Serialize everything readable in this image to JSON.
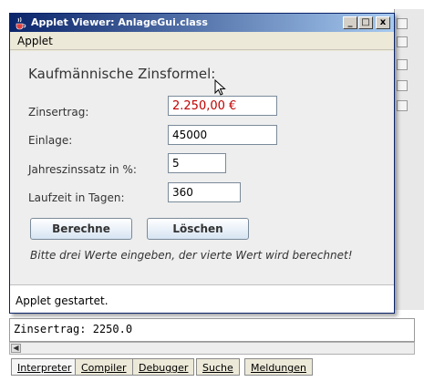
{
  "window": {
    "title": "Applet Viewer: AnlageGui.class",
    "controls": {
      "minimize": "_",
      "maximize": "□",
      "close": "x"
    }
  },
  "menu": {
    "items": [
      "Applet"
    ]
  },
  "form": {
    "heading": "Kaufmännische Zinsformel:",
    "fields": [
      {
        "label": "Zinsertrag:",
        "value": "2.250,00 €",
        "is_result": true
      },
      {
        "label": "Einlage:",
        "value": "45000"
      },
      {
        "label": "Jahreszinssatz in %:",
        "value": "5"
      },
      {
        "label": "Laufzeit in Tagen:",
        "value": "360"
      }
    ],
    "buttons": {
      "calculate": "Berechne",
      "clear": "Löschen"
    },
    "hint": "Bitte drei Werte eingeben, der vierte Wert wird berechnet!"
  },
  "status": {
    "text": "Applet gestartet."
  },
  "console": {
    "output": "Zinsertrag: 2250.0"
  },
  "bottom_tabs": [
    {
      "label": "Interpreter",
      "active": true
    },
    {
      "label": "Compiler"
    },
    {
      "label": "Debugger"
    },
    {
      "label": "Suche"
    },
    {
      "label": "Meldungen"
    }
  ],
  "colors": {
    "titlebar_start": "#0a246a",
    "titlebar_end": "#a6caf0",
    "result_text": "#c00000"
  }
}
